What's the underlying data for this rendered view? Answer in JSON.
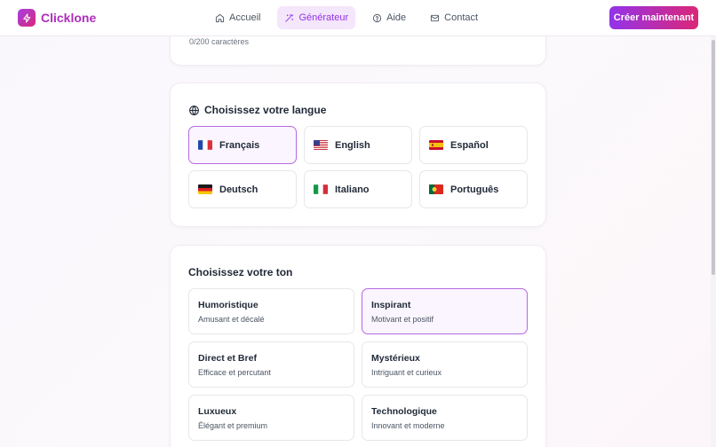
{
  "brand": {
    "name": "Clicklone",
    "accent": "#9333ea",
    "accent2": "#db2777"
  },
  "nav": {
    "items": [
      {
        "label": "Accueil",
        "icon": "home-icon"
      },
      {
        "label": "Générateur",
        "icon": "magic-wand-icon",
        "active": true
      },
      {
        "label": "Aide",
        "icon": "help-circle-icon"
      },
      {
        "label": "Contact",
        "icon": "mail-icon"
      }
    ],
    "cta_label": "Créer maintenant"
  },
  "text_input": {
    "char_count": "0/200 caractères"
  },
  "language": {
    "title": "Choisissez votre langue",
    "options": [
      {
        "label": "Français",
        "flag": "fr",
        "selected": true
      },
      {
        "label": "English",
        "flag": "us",
        "selected": false
      },
      {
        "label": "Español",
        "flag": "es",
        "selected": false
      },
      {
        "label": "Deutsch",
        "flag": "de",
        "selected": false
      },
      {
        "label": "Italiano",
        "flag": "it",
        "selected": false
      },
      {
        "label": "Português",
        "flag": "pt",
        "selected": false
      }
    ]
  },
  "tone": {
    "title": "Choisissez votre ton",
    "options": [
      {
        "name": "Humoristique",
        "desc": "Amusant et décalé",
        "selected": false
      },
      {
        "name": "Inspirant",
        "desc": "Motivant et positif",
        "selected": true
      },
      {
        "name": "Direct et Bref",
        "desc": "Efficace et percutant",
        "selected": false
      },
      {
        "name": "Mystérieux",
        "desc": "Intriguant et curieux",
        "selected": false
      },
      {
        "name": "Luxueux",
        "desc": "Élégant et premium",
        "selected": false
      },
      {
        "name": "Technologique",
        "desc": "Innovant et moderne",
        "selected": false
      }
    ]
  }
}
